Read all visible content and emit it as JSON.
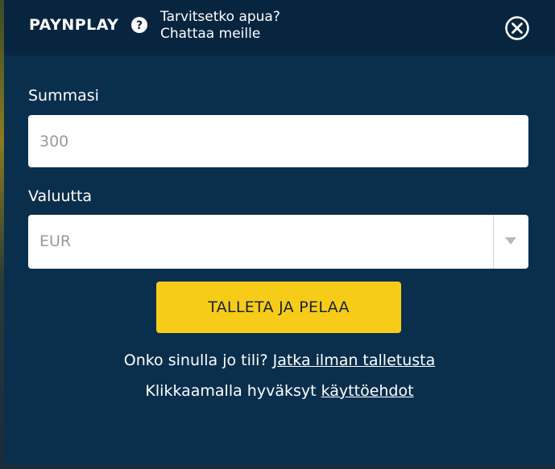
{
  "header": {
    "brand": "PAYNPLAY",
    "help_line1": "Tarvitsetko apua?",
    "help_line2": "Chattaa meille"
  },
  "form": {
    "amount_label": "Summasi",
    "amount_value": "300",
    "currency_label": "Valuutta",
    "currency_value": "EUR",
    "submit_label": "TALLETA JA PELAA"
  },
  "footer": {
    "account_question": "Onko sinulla jo tili?",
    "continue_link": "Jatka ilman talletusta",
    "terms_prefix": "Klikkaamalla hyväksyt",
    "terms_link": "käyttöehdot"
  },
  "colors": {
    "modal_bg": "#0a2f4d",
    "header_bg": "#082540",
    "cta_bg": "#f6cc19"
  },
  "icons": {
    "help": "question-circle-icon",
    "close": "close-circle-icon",
    "dropdown": "chevron-down-icon"
  }
}
